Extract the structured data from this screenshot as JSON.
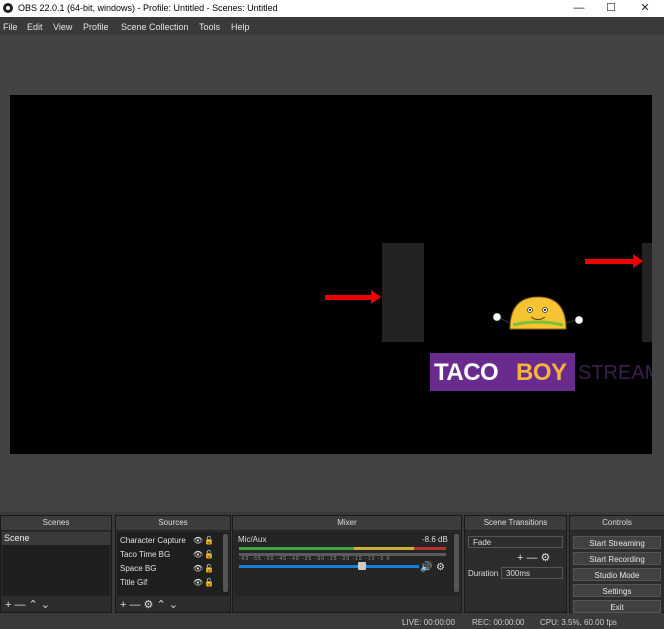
{
  "window": {
    "title": "OBS 22.0.1 (64-bit, windows) - Profile: Untitled - Scenes: Untitled",
    "controls": [
      "—",
      "☐",
      "✕"
    ]
  },
  "menu": [
    "File",
    "Edit",
    "View",
    "Profile",
    "Scene Collection",
    "Tools",
    "Help"
  ],
  "canvas": {
    "banner_word1": "TACO",
    "banner_word2": "BOY",
    "banner_word3": "STREAM",
    "colors": {
      "purple": "#6a2b8e",
      "gold": "#f3b33d",
      "arrow": "#ee0000"
    }
  },
  "docks": {
    "scenes": {
      "title": "Scenes",
      "items": [
        "Scene"
      ],
      "footer": "+ —  ⌃ ⌄"
    },
    "sources": {
      "title": "Sources",
      "items": [
        {
          "name": "Character Capture"
        },
        {
          "name": "Taco Time BG"
        },
        {
          "name": "Space BG"
        },
        {
          "name": "Title Gif"
        }
      ],
      "eye_icon": "👁",
      "lock_icon": "🔓",
      "footer": "+ — ⚙  ⌃ ⌄"
    },
    "mixer": {
      "title": "Mixer",
      "channel": "Mic/Aux",
      "level": "-8.6 dB",
      "scale": "-60 -55 -50 -45 -40 -35 -30 -25 -20 -15 -10 -5 0",
      "volume_fraction": 0.68,
      "speaker_icon": "🔊",
      "gear_icon": "⚙"
    },
    "transitions": {
      "title": "Scene Transitions",
      "transition": "Fade",
      "controls": "+ — ⚙",
      "duration_label": "Duration",
      "duration_value": "300ms"
    },
    "controls": {
      "title": "Controls",
      "buttons": [
        "Start Streaming",
        "Start Recording",
        "Studio Mode",
        "Settings",
        "Exit"
      ]
    }
  },
  "status": {
    "live": "LIVE: 00:00:00",
    "rec": "REC: 00:00:00",
    "cpu": "CPU: 3.5%, 60.00 fps"
  }
}
